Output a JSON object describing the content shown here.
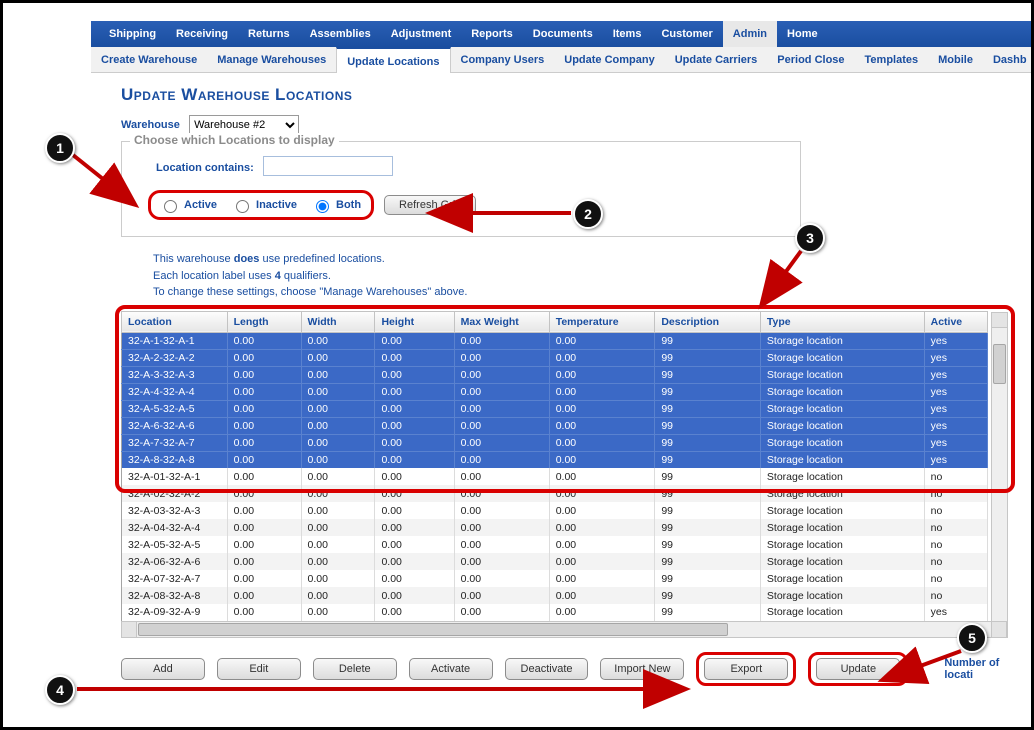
{
  "topnav": {
    "items": [
      "Shipping",
      "Receiving",
      "Returns",
      "Assemblies",
      "Adjustment",
      "Reports",
      "Documents",
      "Items",
      "Customer",
      "Admin",
      "Home"
    ],
    "active_index": 9
  },
  "subnav": {
    "items": [
      "Create Warehouse",
      "Manage Warehouses",
      "Update Locations",
      "Company Users",
      "Update Company",
      "Update Carriers",
      "Period Close",
      "Templates",
      "Mobile",
      "Dashb"
    ],
    "active_index": 2
  },
  "page_title": "Update Warehouse Locations",
  "warehouse": {
    "label": "Warehouse",
    "selected": "Warehouse #2"
  },
  "filter": {
    "legend": "Choose which Locations to display",
    "contains_label": "Location contains:",
    "contains_value": "",
    "radio_active": "Active",
    "radio_inactive": "Inactive",
    "radio_both": "Both",
    "selected_radio": "both",
    "refresh_label": "Refresh Grid"
  },
  "info": {
    "line1_pre": "This warehouse ",
    "line1_b": "does",
    "line1_post": " use predefined locations.",
    "line2_pre": "Each location label uses ",
    "line2_b": "4",
    "line2_post": " qualifiers.",
    "line3": "To change these settings, choose \"Manage Warehouses\" above."
  },
  "grid": {
    "columns": [
      "Location",
      "Length",
      "Width",
      "Height",
      "Max Weight",
      "Temperature",
      "Description",
      "Type",
      "Active"
    ],
    "rows": [
      {
        "sel": true,
        "c": [
          "32-A-1-32-A-1",
          "0.00",
          "0.00",
          "0.00",
          "0.00",
          "0.00",
          "99",
          "Storage location",
          "yes"
        ]
      },
      {
        "sel": true,
        "c": [
          "32-A-2-32-A-2",
          "0.00",
          "0.00",
          "0.00",
          "0.00",
          "0.00",
          "99",
          "Storage location",
          "yes"
        ]
      },
      {
        "sel": true,
        "c": [
          "32-A-3-32-A-3",
          "0.00",
          "0.00",
          "0.00",
          "0.00",
          "0.00",
          "99",
          "Storage location",
          "yes"
        ]
      },
      {
        "sel": true,
        "c": [
          "32-A-4-32-A-4",
          "0.00",
          "0.00",
          "0.00",
          "0.00",
          "0.00",
          "99",
          "Storage location",
          "yes"
        ]
      },
      {
        "sel": true,
        "c": [
          "32-A-5-32-A-5",
          "0.00",
          "0.00",
          "0.00",
          "0.00",
          "0.00",
          "99",
          "Storage location",
          "yes"
        ]
      },
      {
        "sel": true,
        "c": [
          "32-A-6-32-A-6",
          "0.00",
          "0.00",
          "0.00",
          "0.00",
          "0.00",
          "99",
          "Storage location",
          "yes"
        ]
      },
      {
        "sel": true,
        "c": [
          "32-A-7-32-A-7",
          "0.00",
          "0.00",
          "0.00",
          "0.00",
          "0.00",
          "99",
          "Storage location",
          "yes"
        ]
      },
      {
        "sel": true,
        "c": [
          "32-A-8-32-A-8",
          "0.00",
          "0.00",
          "0.00",
          "0.00",
          "0.00",
          "99",
          "Storage location",
          "yes"
        ]
      },
      {
        "sel": false,
        "alt": false,
        "c": [
          "32-A-01-32-A-1",
          "0.00",
          "0.00",
          "0.00",
          "0.00",
          "0.00",
          "99",
          "Storage location",
          "no"
        ]
      },
      {
        "sel": false,
        "alt": true,
        "c": [
          "32-A-02-32-A-2",
          "0.00",
          "0.00",
          "0.00",
          "0.00",
          "0.00",
          "99",
          "Storage location",
          "no"
        ]
      },
      {
        "sel": false,
        "alt": false,
        "c": [
          "32-A-03-32-A-3",
          "0.00",
          "0.00",
          "0.00",
          "0.00",
          "0.00",
          "99",
          "Storage location",
          "no"
        ]
      },
      {
        "sel": false,
        "alt": true,
        "c": [
          "32-A-04-32-A-4",
          "0.00",
          "0.00",
          "0.00",
          "0.00",
          "0.00",
          "99",
          "Storage location",
          "no"
        ]
      },
      {
        "sel": false,
        "alt": false,
        "c": [
          "32-A-05-32-A-5",
          "0.00",
          "0.00",
          "0.00",
          "0.00",
          "0.00",
          "99",
          "Storage location",
          "no"
        ]
      },
      {
        "sel": false,
        "alt": true,
        "c": [
          "32-A-06-32-A-6",
          "0.00",
          "0.00",
          "0.00",
          "0.00",
          "0.00",
          "99",
          "Storage location",
          "no"
        ]
      },
      {
        "sel": false,
        "alt": false,
        "c": [
          "32-A-07-32-A-7",
          "0.00",
          "0.00",
          "0.00",
          "0.00",
          "0.00",
          "99",
          "Storage location",
          "no"
        ]
      },
      {
        "sel": false,
        "alt": true,
        "c": [
          "32-A-08-32-A-8",
          "0.00",
          "0.00",
          "0.00",
          "0.00",
          "0.00",
          "99",
          "Storage location",
          "no"
        ]
      },
      {
        "sel": false,
        "alt": false,
        "c": [
          "32-A-09-32-A-9",
          "0.00",
          "0.00",
          "0.00",
          "0.00",
          "0.00",
          "99",
          "Storage location",
          "yes"
        ]
      }
    ]
  },
  "actions": {
    "add": "Add",
    "edit": "Edit",
    "delete": "Delete",
    "activate": "Activate",
    "deactivate": "Deactivate",
    "import": "Import New",
    "export": "Export",
    "update": "Update"
  },
  "footer": {
    "numloc_label": "Number of locati"
  },
  "markers": {
    "m1": "1",
    "m2": "2",
    "m3": "3",
    "m4": "4",
    "m5": "5"
  }
}
